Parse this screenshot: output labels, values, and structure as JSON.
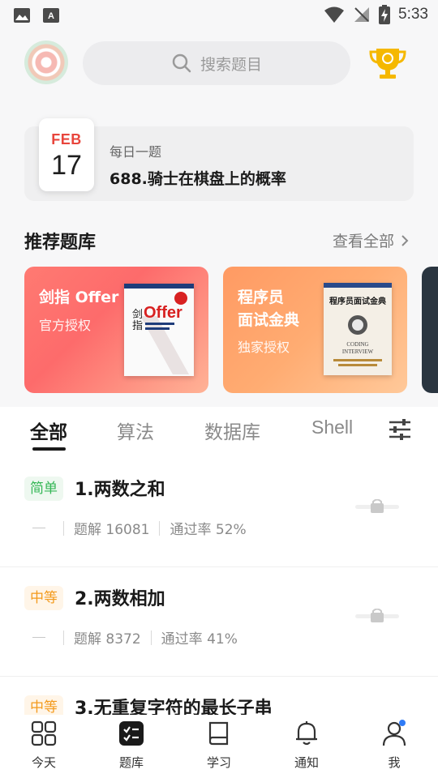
{
  "status_bar": {
    "time": "5:33"
  },
  "header": {
    "search_placeholder": "搜索题目"
  },
  "daily": {
    "month": "FEB",
    "day": "17",
    "label": "每日一题",
    "title": "688.骑士在棋盘上的概率"
  },
  "recommended": {
    "title": "推荐题库",
    "view_all": "查看全部",
    "banks": [
      {
        "name": "剑指 Offer",
        "subtitle": "官方授权"
      },
      {
        "name_line1": "程序员",
        "name_line2": "面试金典",
        "subtitle": "独家授权"
      }
    ]
  },
  "tabs": [
    "全部",
    "算法",
    "数据库",
    "Shell"
  ],
  "questions": [
    {
      "difficulty": "简单",
      "title": "1.两数之和",
      "solutions": "题解 16081",
      "pass_rate": "通过率 52%"
    },
    {
      "difficulty": "中等",
      "title": "2.两数相加",
      "solutions": "题解 8372",
      "pass_rate": "通过率 41%"
    },
    {
      "difficulty": "中等",
      "title": "3.无重复字符的最长子串"
    }
  ],
  "bottom_nav": [
    "今天",
    "题库",
    "学习",
    "通知",
    "我"
  ],
  "colors": {
    "easy": "#36b757",
    "medium": "#f39a1d",
    "accent_red": "#e8453c",
    "trophy": "#f5b800"
  }
}
